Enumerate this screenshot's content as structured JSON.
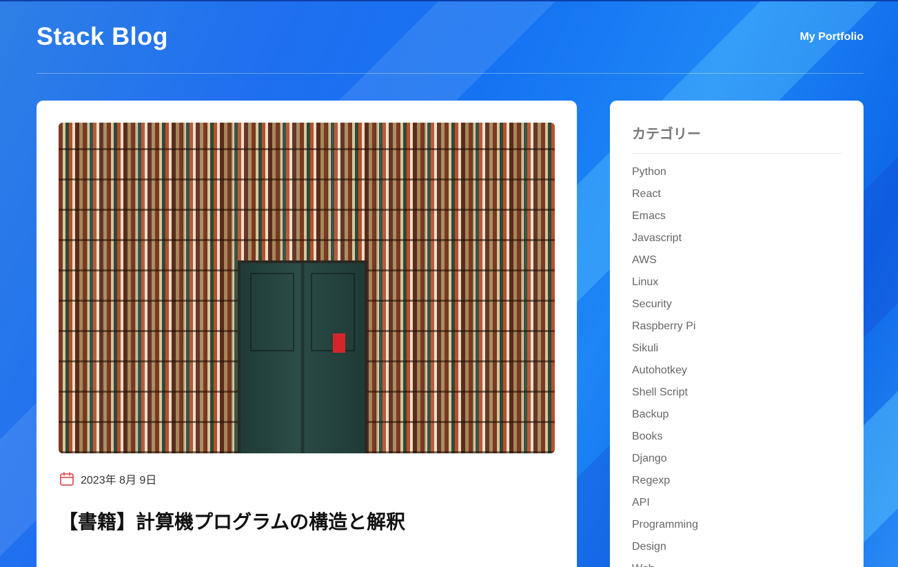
{
  "header": {
    "site_title": "Stack Blog",
    "nav_link": "My Portfolio"
  },
  "post": {
    "date": "2023年 8月 9日",
    "title": "【書籍】計算機プログラムの構造と解釈"
  },
  "sidebar": {
    "title": "カテゴリー",
    "categories": [
      "Python",
      "React",
      "Emacs",
      "Javascript",
      "AWS",
      "Linux",
      "Security",
      "Raspberry Pi",
      "Sikuli",
      "Autohotkey",
      "Shell Script",
      "Backup",
      "Books",
      "Django",
      "Regexp",
      "API",
      "Programming",
      "Design",
      "Web"
    ]
  },
  "colors": {
    "accent": "#e0545a",
    "background": "#1f6ff0",
    "card": "#ffffff"
  }
}
